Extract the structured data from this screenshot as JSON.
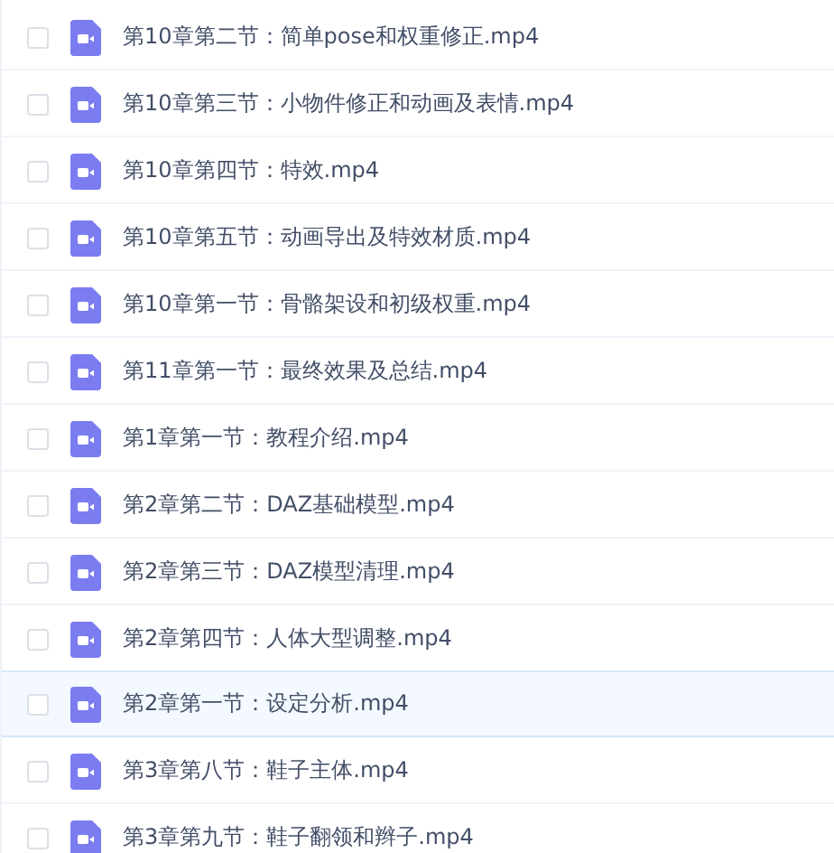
{
  "files": [
    {
      "name": "第10章第二节：简单pose和权重修正.mp4",
      "checked": false,
      "highlighted": false
    },
    {
      "name": "第10章第三节：小物件修正和动画及表情.mp4",
      "checked": false,
      "highlighted": false
    },
    {
      "name": "第10章第四节：特效.mp4",
      "checked": false,
      "highlighted": false
    },
    {
      "name": "第10章第五节：动画导出及特效材质.mp4",
      "checked": false,
      "highlighted": false
    },
    {
      "name": "第10章第一节：骨骼架设和初级权重.mp4",
      "checked": false,
      "highlighted": false
    },
    {
      "name": "第11章第一节：最终效果及总结.mp4",
      "checked": false,
      "highlighted": false
    },
    {
      "name": "第1章第一节：教程介绍.mp4",
      "checked": false,
      "highlighted": false
    },
    {
      "name": "第2章第二节：DAZ基础模型.mp4",
      "checked": false,
      "highlighted": false
    },
    {
      "name": "第2章第三节：DAZ模型清理.mp4",
      "checked": false,
      "highlighted": false
    },
    {
      "name": "第2章第四节：人体大型调整.mp4",
      "checked": false,
      "highlighted": false
    },
    {
      "name": "第2章第一节：设定分析.mp4",
      "checked": false,
      "highlighted": true
    },
    {
      "name": "第3章第八节：鞋子主体.mp4",
      "checked": false,
      "highlighted": false
    },
    {
      "name": "第3章第九节：鞋子翻领和辫子.mp4",
      "checked": false,
      "highlighted": false
    }
  ]
}
